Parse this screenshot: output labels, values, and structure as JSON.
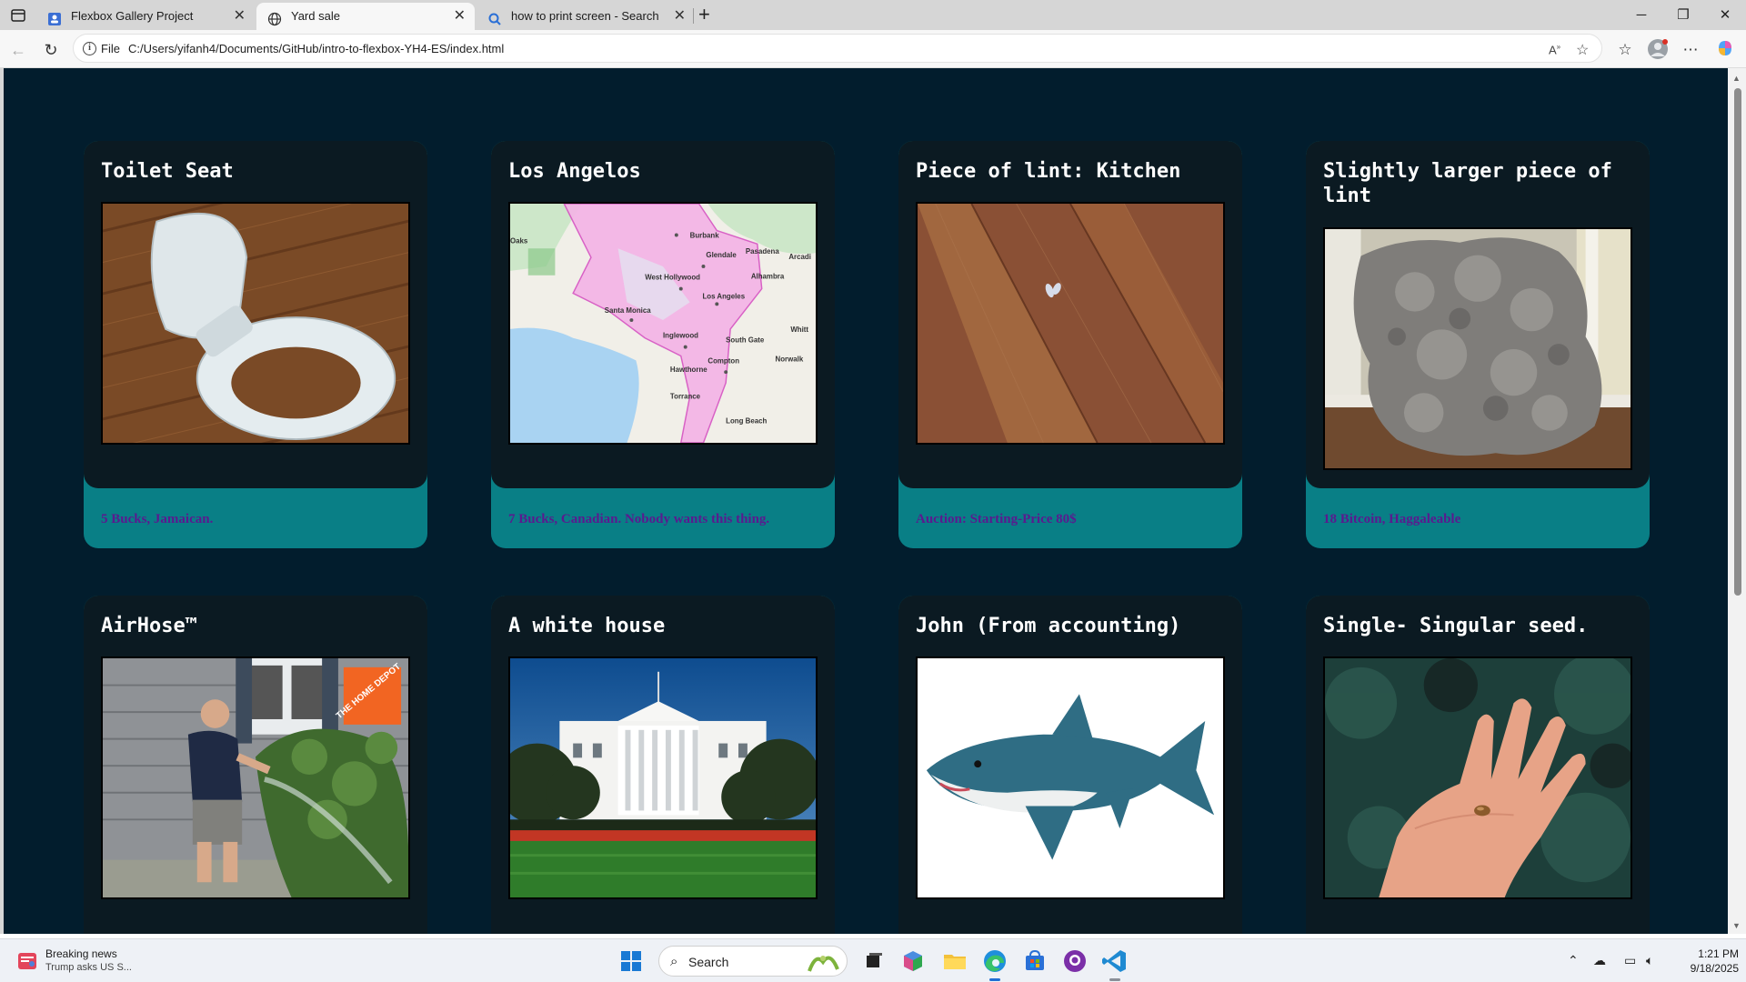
{
  "browser": {
    "tabs": [
      {
        "label": "Flexbox Gallery Project",
        "active": false
      },
      {
        "label": "Yard sale",
        "active": true
      },
      {
        "label": "how to print screen - Search",
        "active": false
      }
    ],
    "address": {
      "scheme_label": "File",
      "url": "C:/Users/yifanh4/Documents/GitHub/intro-to-flexbox-YH4-ES/index.html"
    }
  },
  "page": {
    "background": "#021d2d",
    "card_color": "#0b1a22",
    "price_band_color": "#097f86",
    "price_text_color": "#5a1a8f",
    "items": [
      {
        "title": "Toilet Seat",
        "price": "5 Bucks, Jamaican.",
        "image": "toilet-seat-photo"
      },
      {
        "title": "Los Angelos",
        "price": "7 Bucks, Canadian. Nobody wants this thing.",
        "image": "los-angeles-map"
      },
      {
        "title": "Piece of lint: Kitchen",
        "price": "Auction: Starting-Price 80$",
        "image": "lint-on-floor-photo"
      },
      {
        "title": "Slightly larger piece of lint",
        "price": "18 Bitcoin, Haggaleable",
        "image": "dryer-lint-pile-photo"
      },
      {
        "title": "AirHose™",
        "price": "",
        "image": "man-with-hose-photo"
      },
      {
        "title": "A white house",
        "price": "",
        "image": "white-house-photo"
      },
      {
        "title": "John (From accounting)",
        "price": "",
        "image": "plush-shark-photo"
      },
      {
        "title": "Single- Singular seed.",
        "price": "",
        "image": "seed-in-hand-photo"
      }
    ],
    "map_labels": [
      "Burbank",
      "Glendale",
      "Pasadena",
      "West Hollywood",
      "Alhambra",
      "Los Angeles",
      "Santa Monica",
      "Inglewood",
      "South Gate",
      "Norwalk",
      "Hawthorne",
      "Compton",
      "Torrance",
      "Long Beach",
      "Whitt",
      "Arcadi",
      "Oaks"
    ],
    "store_logo_text": "THE HOME DEPOT"
  },
  "taskbar": {
    "news_title": "Breaking news",
    "news_sub": "Trump asks US S...",
    "search_placeholder": "Search",
    "time": "1:21 PM",
    "date": "9/18/2025"
  }
}
